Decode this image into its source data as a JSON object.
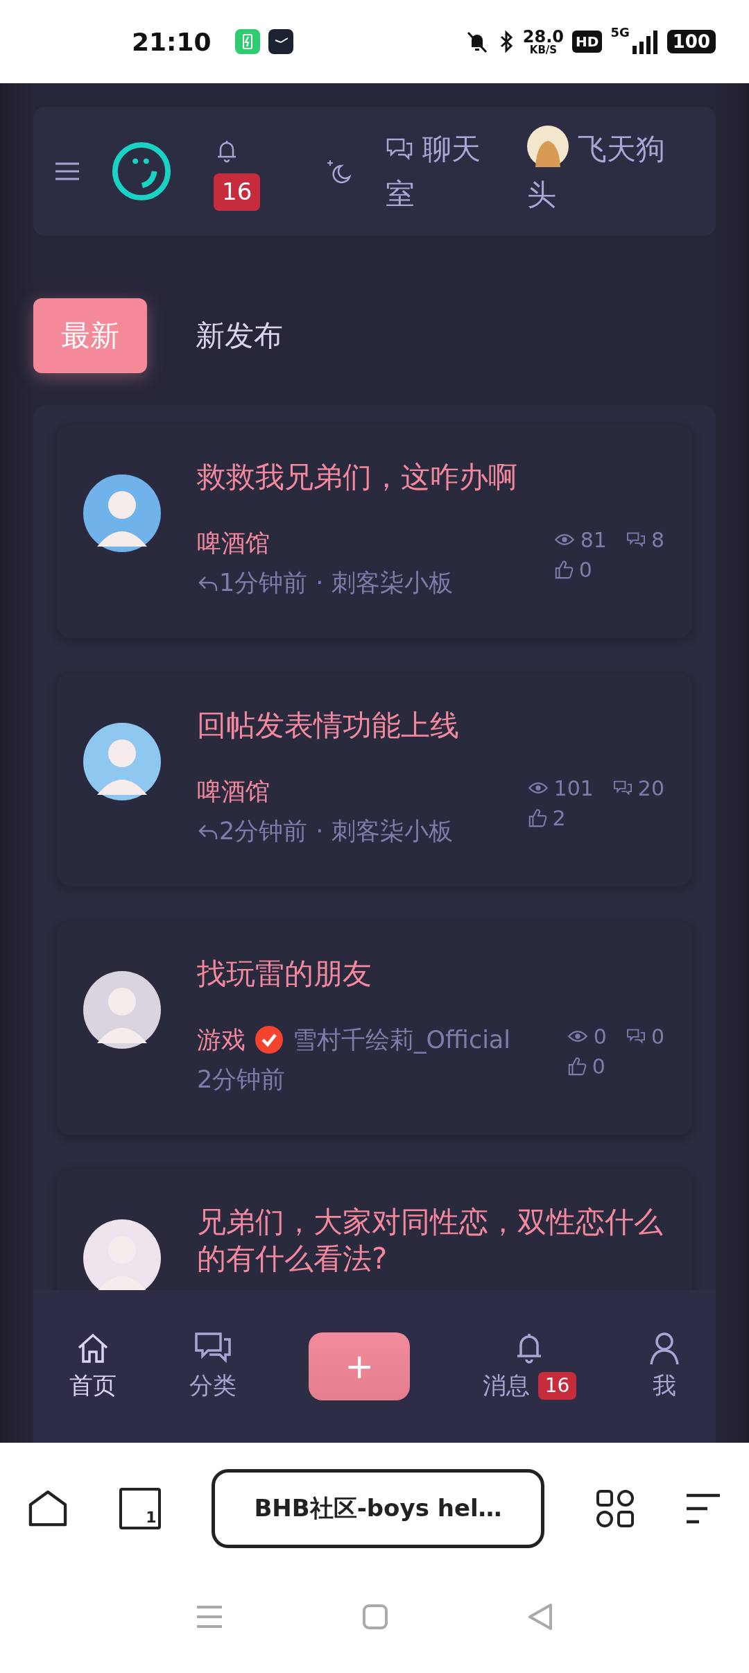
{
  "status_bar": {
    "time": "21:10",
    "speed": "28.0",
    "speed_unit": "KB/S",
    "hd": "HD",
    "network": "5G",
    "battery": "100"
  },
  "header": {
    "notification_count": "16",
    "chat_label": "聊天室",
    "user_name": "飞天狗头"
  },
  "tabs": [
    {
      "label": "最新",
      "selected": true
    },
    {
      "label": "新发布",
      "selected": false
    }
  ],
  "posts": [
    {
      "kind": "reply",
      "title": "救救我兄弟们，这咋办啊",
      "category": "啤酒馆",
      "time": "1分钟前",
      "separator": "·",
      "user": "刺客柒小板",
      "views": "81",
      "comments": "8",
      "likes": "0"
    },
    {
      "kind": "reply",
      "title": "回帖发表情功能上线",
      "category": "啤酒馆",
      "time": "2分钟前",
      "separator": "·",
      "user": "刺客柒小板",
      "views": "101",
      "comments": "20",
      "likes": "2"
    },
    {
      "kind": "author",
      "title": "找玩雷的朋友",
      "category": "游戏",
      "verified": true,
      "user": "雪村千绘莉_Official",
      "time": "2分钟前",
      "views": "0",
      "comments": "0",
      "likes": "0"
    },
    {
      "kind": "partial",
      "title": "兄弟们，大家对同性恋，双性恋什么的有什么看法?"
    }
  ],
  "bottom_nav": [
    {
      "kind": "home",
      "label": "首页",
      "selected": true
    },
    {
      "kind": "category",
      "label": "分类",
      "selected": false
    },
    {
      "kind": "post",
      "label": "+",
      "selected": false
    },
    {
      "kind": "messages",
      "label": "消息",
      "badge": "16",
      "selected": false
    },
    {
      "kind": "me",
      "label": "我",
      "selected": false
    }
  ],
  "browser": {
    "tab_count": "1",
    "url": "BHB社区-boys hel…"
  }
}
